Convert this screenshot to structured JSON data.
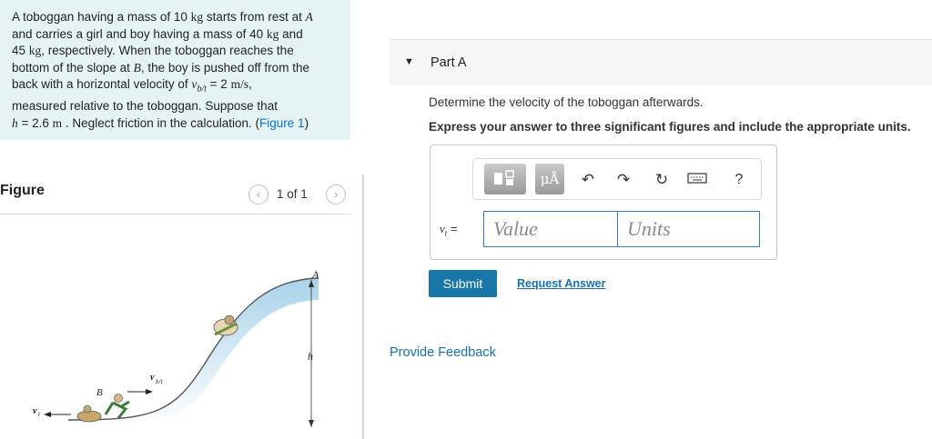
{
  "problem": {
    "t1": "A toboggan having a mass of 10 ",
    "u1": "kg",
    "t2": " starts from rest at ",
    "v1": "A",
    "t3": "and carries a girl and boy having a mass of 40 ",
    "u2": "kg",
    "t4": " and",
    "t5": "45 ",
    "u3": "kg",
    "t6": ", respectively. When the toboggan reaches the",
    "t7": "bottom of the slope at ",
    "v2": "B",
    "t8": ", the boy is pushed off from the",
    "t9": "back with a horizontal velocity of ",
    "v3": "v",
    "v3sub": "b/t",
    "t10": " = 2 ",
    "u4": "m/s",
    "t11": ",",
    "t12": "measured relative to the toboggan. Suppose that",
    "v4": "h",
    "t13": " = 2.6 ",
    "u5": "m",
    "t14": " . Neglect friction in the calculation. (",
    "link": "Figure 1",
    "t15": ")"
  },
  "figure": {
    "title": "Figure",
    "counter": "1 of 1",
    "label_A": "A",
    "label_B": "B",
    "label_h": "h",
    "label_vt": "v",
    "label_vt_sub": "t",
    "label_vbt": "v",
    "label_vbt_sub": "b/t"
  },
  "part": {
    "title": "Part A",
    "question": "Determine the velocity of the toboggan afterwards.",
    "instruction": "Express your answer to three significant figures and include the appropriate units."
  },
  "answer": {
    "var": "v",
    "var_sub": "t",
    "equals": " =",
    "value_placeholder": "Value",
    "units_placeholder": "Units",
    "units_btn": "μÅ"
  },
  "icons": {
    "templates": "templates-icon",
    "units": "units-icon",
    "undo": "undo-icon",
    "redo": "redo-icon",
    "reset": "reset-icon",
    "keyboard": "keyboard-icon",
    "help": "help-icon"
  },
  "toolbar": {
    "help": "?"
  },
  "actions": {
    "submit": "Submit",
    "request": "Request Answer",
    "feedback": "Provide Feedback"
  },
  "colors": {
    "accent": "#1976a8",
    "link": "#1a6fb0",
    "panel": "#e6f3f5"
  }
}
